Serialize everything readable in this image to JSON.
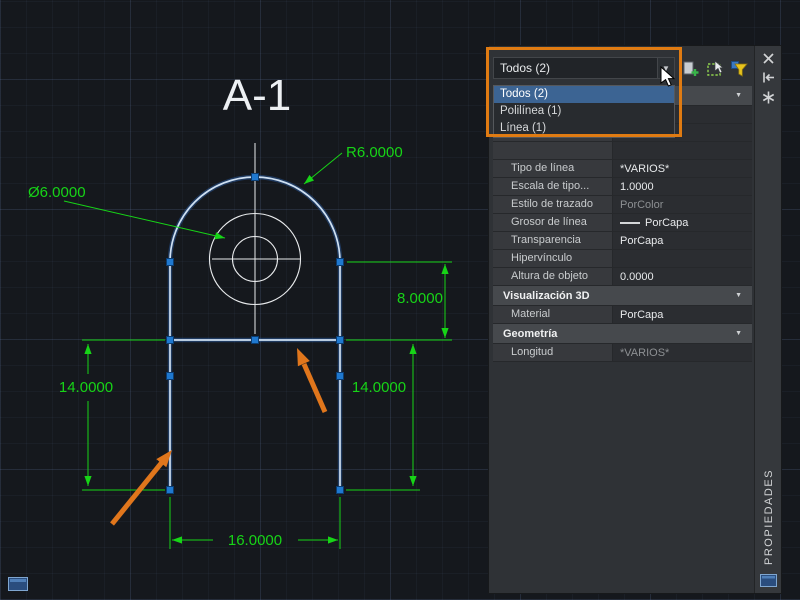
{
  "colors": {
    "canvas_bg": "#15181d",
    "dimension_green": "#17d417",
    "selection_line": "#cfe0f2",
    "grip_blue": "#1f78cf",
    "annotation_orange": "#e0761c",
    "callout_orange": "#e07b12",
    "palette_bg": "#2f3236",
    "dropdown_highlight": "#3c6493"
  },
  "drawing": {
    "title": "A-1",
    "dimensions": {
      "radius": "R6.0000",
      "diameter": "Ø6.0000",
      "slot_height": "8.0000",
      "left_height": "14.0000",
      "right_height": "14.0000",
      "bottom_width": "16.0000"
    }
  },
  "palette": {
    "vertical_title": "PROPIEDADES",
    "selector_value": "Todos (2)",
    "dropdown_items": [
      {
        "label": "Todos (2)"
      },
      {
        "label": "Polilínea (1)"
      },
      {
        "label": "Línea (1)"
      }
    ],
    "general_rows": [
      {
        "label": "Tipo de línea",
        "value": "*VARIOS*"
      },
      {
        "label": "Escala de tipo...",
        "value": "1.0000"
      },
      {
        "label": "Estilo de trazado",
        "value": "PorColor"
      },
      {
        "label": "Grosor de línea",
        "value": "PorCapa"
      },
      {
        "label": "Transparencia",
        "value": "PorCapa"
      },
      {
        "label": "Hipervínculo",
        "value": ""
      },
      {
        "label": "Altura de objeto",
        "value": "0.0000"
      }
    ],
    "category_3d": "Visualización 3D",
    "rows_3d": [
      {
        "label": "Material",
        "value": "PorCapa"
      }
    ],
    "category_geometry": "Geometría",
    "rows_geometry": [
      {
        "label": "Longitud",
        "value": "*VARIOS*"
      }
    ]
  },
  "icons": {
    "combo_arrow": "▼",
    "collapse_arrow": "▼"
  }
}
